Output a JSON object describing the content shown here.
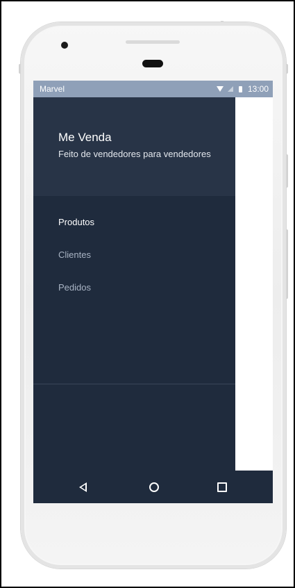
{
  "status_bar": {
    "carrier": "Marvel",
    "time": "13:00",
    "icons": [
      "wifi-icon",
      "signal-icon",
      "battery-icon"
    ]
  },
  "drawer": {
    "title": "Me Venda",
    "subtitle": "Feito de vendedores para vendedores",
    "items": [
      {
        "label": "Produtos",
        "active": true
      },
      {
        "label": "Clientes",
        "active": false
      },
      {
        "label": "Pedidos",
        "active": false
      }
    ]
  },
  "nav_bar": {
    "icons": [
      "back-icon",
      "home-icon",
      "recent-apps-icon"
    ]
  },
  "colors": {
    "status_bar": "#8fa0b8",
    "drawer_bg": "#1f2b3d",
    "drawer_header_bg": "#283447",
    "active_text": "#ffffff",
    "inactive_text": "#a9b4c4"
  }
}
